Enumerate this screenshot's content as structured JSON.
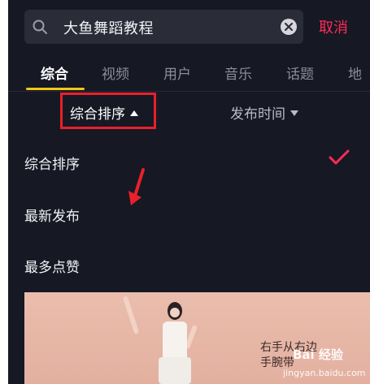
{
  "search": {
    "query": "大鱼舞蹈教程",
    "cancel_label": "取消"
  },
  "tabs": [
    {
      "label": "综合",
      "active": true
    },
    {
      "label": "视频"
    },
    {
      "label": "用户"
    },
    {
      "label": "音乐"
    },
    {
      "label": "话题"
    },
    {
      "label": "地"
    }
  ],
  "sort_bar": {
    "primary_label": "综合排序",
    "secondary_label": "发布时间"
  },
  "sort_menu": {
    "items": [
      {
        "label": "综合排序",
        "selected": true
      },
      {
        "label": "最新发布"
      },
      {
        "label": "最多点赞"
      }
    ]
  },
  "video": {
    "caption_line1": "右手从右边",
    "caption_line2": "手腕带"
  },
  "watermark": {
    "brand": "Bai 经验",
    "url": "jingyan.baidu.com"
  },
  "colors": {
    "accent": "#fe2c55",
    "tab_underline": "#f5c518",
    "highlight": "#e8202a"
  }
}
